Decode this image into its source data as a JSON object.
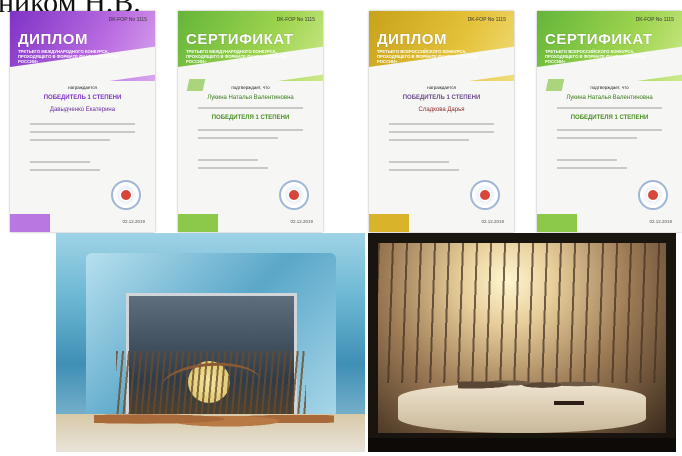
{
  "caption": {
    "visible_text": "ником Н.В."
  },
  "certificates": [
    {
      "title": "ДИПЛОМ",
      "subtitle": "Третьего Международного конкурса, проходящего в формате Фанта «Таланты России»",
      "number": "DK-FOP No 1115",
      "award_intro": "награждается",
      "winner": "ПОБЕДИТЕЛЬ 1 СТЕПЕНИ",
      "person": "Давыдченко Екатерина",
      "date": "02.12.2019",
      "accent": "#7e33c5"
    },
    {
      "title": "СЕРТИФИКАТ",
      "subtitle": "Третьего Международного конкурса, проходящего в формате Фанта «Таланты России»",
      "number": "DK-FOP No 1115",
      "award_intro": "подтверждает, что",
      "winner": "ПОБЕДИТЕЛЯ 1 СТЕПЕНИ",
      "person": "Лукина Наталья Валентиновна",
      "date": "02.12.2019",
      "accent": "#64b53a"
    },
    {
      "title": "ДИПЛОМ",
      "subtitle": "Третьего Всероссийского конкурса, проходящего в формате Фанта «Таланты России»",
      "number": "DK-FOP No 1115",
      "award_intro": "награждается",
      "winner": "ПОБЕДИТЕЛЬ 1 СТЕПЕНИ",
      "person": "Сладкова Дарья",
      "date": "02.12.2019",
      "accent": "#c7a21a"
    },
    {
      "title": "СЕРТИФИКАТ",
      "subtitle": "Третьего Всероссийского конкурса, проходящего в формате Фанта «Таланты России»",
      "number": "DK-FOP No 1115",
      "award_intro": "подтверждает, что",
      "winner": "ПОБЕДИТЕЛЯ 1 СТЕПЕНИ",
      "person": "Лукина Наталья Валентиновна",
      "date": "02.12.2019",
      "accent": "#64b53a"
    }
  ],
  "photos": [
    {
      "name": "theatre-model-winter-blue"
    },
    {
      "name": "theatre-model-forest-dark"
    }
  ]
}
